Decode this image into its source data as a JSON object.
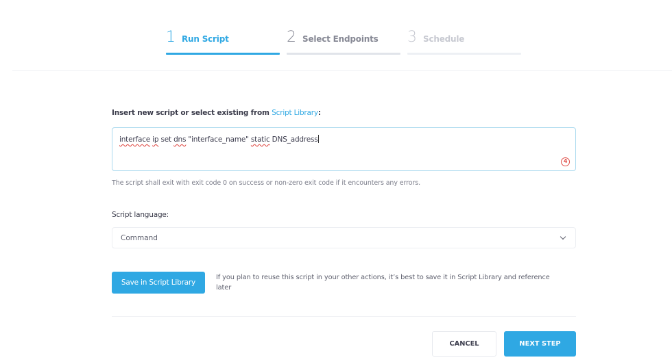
{
  "stepper": {
    "steps": [
      {
        "number": "1",
        "label": "Run Script",
        "state": "active"
      },
      {
        "number": "2",
        "label": "Select Endpoints",
        "state": "next"
      },
      {
        "number": "3",
        "label": "Schedule",
        "state": "future"
      }
    ]
  },
  "script": {
    "label_prefix": "Insert new script or select existing from ",
    "label_link": "Script Library",
    "label_suffix": ":",
    "value_tokens": [
      {
        "text": "interface",
        "spellcheck_error": true
      },
      {
        "text": " ",
        "spellcheck_error": false
      },
      {
        "text": "ip",
        "spellcheck_error": true
      },
      {
        "text": " set ",
        "spellcheck_error": false
      },
      {
        "text": "dns",
        "spellcheck_error": true
      },
      {
        "text": " \"interface_name\" ",
        "spellcheck_error": false
      },
      {
        "text": "static",
        "spellcheck_error": true
      },
      {
        "text": " DNS_address",
        "spellcheck_error": false
      }
    ],
    "grammar_badge_count": "4",
    "hint": "The script shall exit with exit code 0 on success or non-zero exit code if it encounters any errors."
  },
  "language": {
    "label": "Script language:",
    "selected": "Command"
  },
  "library": {
    "save_button": "Save in Script Library",
    "hint": "If you plan to reuse this script in your other actions, it’s best to save it in Script Library and reference later"
  },
  "footer": {
    "cancel_button": "CANCEL",
    "next_button": "NEXT STEP"
  },
  "colors": {
    "accent": "#2fa8e3",
    "spellcheck": "#e0504a"
  }
}
